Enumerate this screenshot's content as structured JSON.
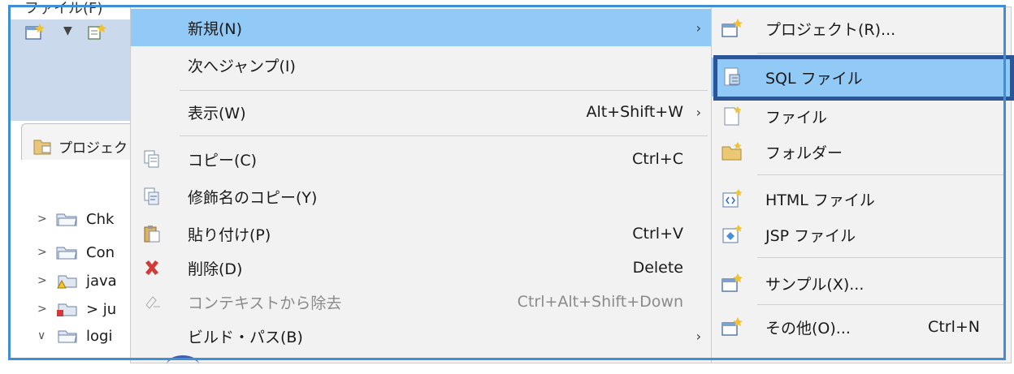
{
  "ide": {
    "menubar_label": "ファイル(F)",
    "panel_tab_label": "プロジェク",
    "tree": [
      {
        "label": "Chk",
        "chevron": ">"
      },
      {
        "label": "Con",
        "chevron": ">"
      },
      {
        "label": "java",
        "chevron": ">"
      },
      {
        "label": "> ju",
        "chevron": ">"
      },
      {
        "label": "logi",
        "chevron": "∨"
      }
    ]
  },
  "context_menu": {
    "items": [
      {
        "label": "新規(N)",
        "accel": "",
        "arrow": "›",
        "icon": "none",
        "highlighted": true
      },
      {
        "label": "次へジャンプ(I)",
        "accel": "",
        "arrow": "",
        "icon": "none"
      },
      {
        "label": "表示(W)",
        "accel": "Alt+Shift+W",
        "arrow": "›",
        "icon": "none"
      },
      {
        "label": "コピー(C)",
        "accel": "Ctrl+C",
        "arrow": "",
        "icon": "copy-icon"
      },
      {
        "label": "修飾名のコピー(Y)",
        "accel": "",
        "arrow": "",
        "icon": "copy-qualified-name-icon"
      },
      {
        "label": "貼り付け(P)",
        "accel": "Ctrl+V",
        "arrow": "",
        "icon": "paste-icon"
      },
      {
        "label": "削除(D)",
        "accel": "Delete",
        "arrow": "",
        "icon": "delete-icon"
      },
      {
        "label": "コンテキストから除去",
        "accel": "Ctrl+Alt+Shift+Down",
        "arrow": "",
        "icon": "remove-context-icon",
        "disabled": true
      },
      {
        "label": "ビルド・パス(B)",
        "accel": "",
        "arrow": "›",
        "icon": "none"
      }
    ]
  },
  "submenu": {
    "items": [
      {
        "label": "プロジェクト(R)...",
        "accel": "",
        "icon": "new-project-icon"
      },
      {
        "label": "SQL ファイル",
        "accel": "",
        "icon": "sql-file-icon",
        "highlighted": true
      },
      {
        "label": "ファイル",
        "accel": "",
        "icon": "new-file-icon"
      },
      {
        "label": "フォルダー",
        "accel": "",
        "icon": "new-folder-icon"
      },
      {
        "label": "HTML ファイル",
        "accel": "",
        "icon": "html-file-icon"
      },
      {
        "label": "JSP ファイル",
        "accel": "",
        "icon": "jsp-file-icon"
      },
      {
        "label": "サンプル(X)...",
        "accel": "",
        "icon": "example-icon"
      },
      {
        "label": "その他(O)...",
        "accel": "Ctrl+N",
        "icon": "other-wizard-icon"
      }
    ]
  },
  "colors": {
    "highlight": "#91c9f7",
    "frame": "#3e8fd8",
    "callout_box": "#2a5597",
    "toolbar_bg": "#cad9ec",
    "delete_red": "#d23a3a"
  }
}
